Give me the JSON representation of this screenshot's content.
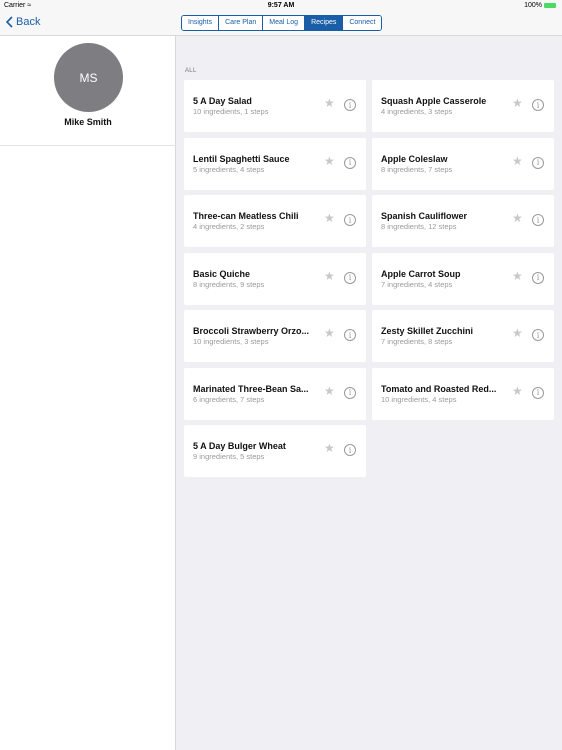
{
  "status_bar": {
    "carrier": "Carrier",
    "wifi_icon": "wifi-icon",
    "time": "9:57 AM",
    "battery_percent": "100%",
    "battery_icon": "battery-icon"
  },
  "nav": {
    "back_label": "Back",
    "tabs": [
      {
        "label": "Insights",
        "active": false
      },
      {
        "label": "Care Plan",
        "active": false
      },
      {
        "label": "Meal Log",
        "active": false
      },
      {
        "label": "Recipes",
        "active": true
      },
      {
        "label": "Connect",
        "active": false
      }
    ]
  },
  "sidebar": {
    "avatar_initials": "MS",
    "user_name": "Mike Smith"
  },
  "main": {
    "section_label": "ALL",
    "recipes": [
      {
        "title": "5 A Day Salad",
        "subtitle": "10 ingredients, 1 steps"
      },
      {
        "title": "Squash Apple Casserole",
        "subtitle": "4 ingredients, 3 steps"
      },
      {
        "title": "Lentil Spaghetti Sauce",
        "subtitle": "5 ingredients, 4 steps"
      },
      {
        "title": "Apple Coleslaw",
        "subtitle": "8 ingredients, 7 steps"
      },
      {
        "title": "Three-can Meatless Chili",
        "subtitle": "4 ingredients, 2 steps"
      },
      {
        "title": "Spanish Cauliflower",
        "subtitle": "8 ingredients, 12 steps"
      },
      {
        "title": "Basic Quiche",
        "subtitle": "8 ingredients, 9 steps"
      },
      {
        "title": "Apple Carrot Soup",
        "subtitle": "7 ingredients, 4 steps"
      },
      {
        "title": "Broccoli Strawberry Orzo...",
        "subtitle": "10 ingredients, 3 steps"
      },
      {
        "title": "Zesty Skillet Zucchini",
        "subtitle": "7 ingredients, 8 steps"
      },
      {
        "title": "Marinated Three-Bean Sa...",
        "subtitle": "6 ingredients, 7 steps"
      },
      {
        "title": "Tomato and Roasted Red...",
        "subtitle": "10 ingredients, 4 steps"
      },
      {
        "title": "5 A Day Bulger Wheat",
        "subtitle": "9 ingredients, 5 steps"
      }
    ],
    "star_glyph": "★",
    "info_glyph": "i"
  }
}
